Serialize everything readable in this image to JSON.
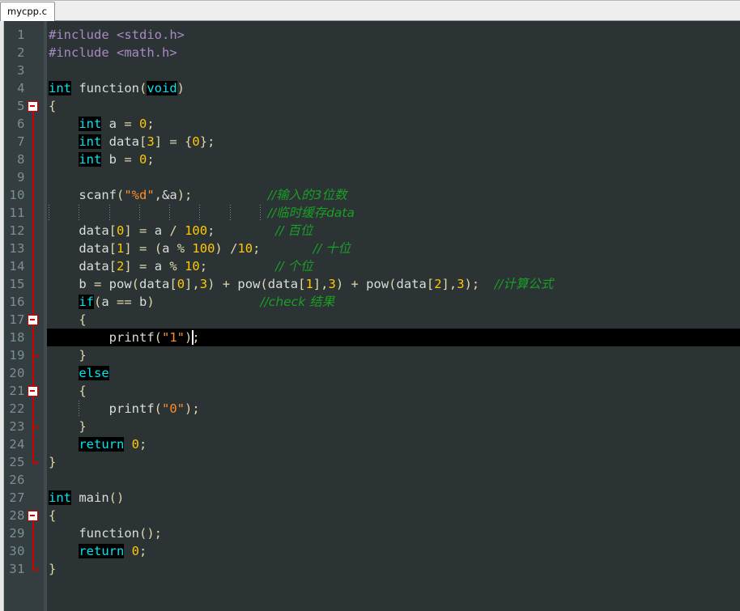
{
  "window": {
    "tabs": [
      {
        "label": "mycpp.c",
        "active": true
      }
    ]
  },
  "editor": {
    "theme": {
      "background": "#2b3335",
      "gutter_background": "#343d40",
      "line_number_color": "#7b9094",
      "current_line_background": "#000000",
      "keyword_color": "#00e5ee",
      "keyword_background": "#000000",
      "preprocessor_color": "#a98ac4",
      "string_color": "#ff8c28",
      "number_color": "#ffc800",
      "bracket_color": "#e0d6a8",
      "comment_color": "#1a9f25",
      "default_text_color": "#dcdcdc",
      "fold_marker_color": "#d00000",
      "caret_color": "#ffffff"
    },
    "current_line": 18,
    "total_lines": 31,
    "language": "C",
    "lines": [
      {
        "n": 1,
        "tokens": [
          {
            "t": "#include ",
            "c": "pre"
          },
          {
            "t": "<stdio.h>",
            "c": "pre"
          }
        ]
      },
      {
        "n": 2,
        "tokens": [
          {
            "t": "#include ",
            "c": "pre"
          },
          {
            "t": "<math.h>",
            "c": "pre"
          }
        ]
      },
      {
        "n": 3,
        "tokens": []
      },
      {
        "n": 4,
        "tokens": [
          {
            "t": "int",
            "c": "kw"
          },
          {
            "t": " function",
            "c": "id"
          },
          {
            "t": "(",
            "c": "brk"
          },
          {
            "t": "void",
            "c": "kw"
          },
          {
            "t": ")",
            "c": "brk"
          }
        ]
      },
      {
        "n": 5,
        "tokens": [
          {
            "t": "{",
            "c": "brk"
          }
        ]
      },
      {
        "n": 6,
        "tokens": [
          {
            "t": "    ",
            "c": "id"
          },
          {
            "t": "int",
            "c": "kw"
          },
          {
            "t": " a ",
            "c": "id"
          },
          {
            "t": "=",
            "c": "op"
          },
          {
            "t": " ",
            "c": "id"
          },
          {
            "t": "0",
            "c": "num"
          },
          {
            "t": ";",
            "c": "op"
          }
        ]
      },
      {
        "n": 7,
        "tokens": [
          {
            "t": "    ",
            "c": "id"
          },
          {
            "t": "int",
            "c": "kw"
          },
          {
            "t": " data",
            "c": "id"
          },
          {
            "t": "[",
            "c": "brk"
          },
          {
            "t": "3",
            "c": "num"
          },
          {
            "t": "]",
            "c": "brk"
          },
          {
            "t": " ",
            "c": "id"
          },
          {
            "t": "=",
            "c": "op"
          },
          {
            "t": " ",
            "c": "id"
          },
          {
            "t": "{",
            "c": "brk"
          },
          {
            "t": "0",
            "c": "num"
          },
          {
            "t": "}",
            "c": "brk"
          },
          {
            "t": ";",
            "c": "op"
          }
        ]
      },
      {
        "n": 8,
        "tokens": [
          {
            "t": "    ",
            "c": "id"
          },
          {
            "t": "int",
            "c": "kw"
          },
          {
            "t": " b ",
            "c": "id"
          },
          {
            "t": "=",
            "c": "op"
          },
          {
            "t": " ",
            "c": "id"
          },
          {
            "t": "0",
            "c": "num"
          },
          {
            "t": ";",
            "c": "op"
          }
        ]
      },
      {
        "n": 9,
        "tokens": []
      },
      {
        "n": 10,
        "tokens": [
          {
            "t": "    scanf",
            "c": "id"
          },
          {
            "t": "(",
            "c": "brk"
          },
          {
            "t": "\"%d\"",
            "c": "str"
          },
          {
            "t": ",",
            "c": "op"
          },
          {
            "t": "&a",
            "c": "id"
          },
          {
            "t": ")",
            "c": "brk"
          },
          {
            "t": ";",
            "c": "op"
          },
          {
            "t": "          ",
            "c": "id"
          },
          {
            "t": "//输入的3位数",
            "c": "cmtcn"
          }
        ]
      },
      {
        "n": 11,
        "tokens": [
          {
            "t": "                             ",
            "c": "id"
          },
          {
            "t": "//临时缓存data",
            "c": "cmtcn"
          }
        ]
      },
      {
        "n": 12,
        "tokens": [
          {
            "t": "    data",
            "c": "id"
          },
          {
            "t": "[",
            "c": "brk"
          },
          {
            "t": "0",
            "c": "num"
          },
          {
            "t": "]",
            "c": "brk"
          },
          {
            "t": " ",
            "c": "id"
          },
          {
            "t": "=",
            "c": "op"
          },
          {
            "t": " a ",
            "c": "id"
          },
          {
            "t": "/",
            "c": "op"
          },
          {
            "t": " ",
            "c": "id"
          },
          {
            "t": "100",
            "c": "num"
          },
          {
            "t": ";",
            "c": "op"
          },
          {
            "t": "        ",
            "c": "id"
          },
          {
            "t": "// 百位",
            "c": "cmtcn"
          }
        ]
      },
      {
        "n": 13,
        "tokens": [
          {
            "t": "    data",
            "c": "id"
          },
          {
            "t": "[",
            "c": "brk"
          },
          {
            "t": "1",
            "c": "num"
          },
          {
            "t": "]",
            "c": "brk"
          },
          {
            "t": " ",
            "c": "id"
          },
          {
            "t": "=",
            "c": "op"
          },
          {
            "t": " ",
            "c": "id"
          },
          {
            "t": "(",
            "c": "brk"
          },
          {
            "t": "a ",
            "c": "id"
          },
          {
            "t": "%",
            "c": "op"
          },
          {
            "t": " ",
            "c": "id"
          },
          {
            "t": "100",
            "c": "num"
          },
          {
            "t": ")",
            "c": "brk"
          },
          {
            "t": " ",
            "c": "id"
          },
          {
            "t": "/",
            "c": "op"
          },
          {
            "t": "10",
            "c": "num"
          },
          {
            "t": ";",
            "c": "op"
          },
          {
            "t": "       ",
            "c": "id"
          },
          {
            "t": "// 十位",
            "c": "cmtcn"
          }
        ]
      },
      {
        "n": 14,
        "tokens": [
          {
            "t": "    data",
            "c": "id"
          },
          {
            "t": "[",
            "c": "brk"
          },
          {
            "t": "2",
            "c": "num"
          },
          {
            "t": "]",
            "c": "brk"
          },
          {
            "t": " ",
            "c": "id"
          },
          {
            "t": "=",
            "c": "op"
          },
          {
            "t": " a ",
            "c": "id"
          },
          {
            "t": "%",
            "c": "op"
          },
          {
            "t": " ",
            "c": "id"
          },
          {
            "t": "10",
            "c": "num"
          },
          {
            "t": ";",
            "c": "op"
          },
          {
            "t": "         ",
            "c": "id"
          },
          {
            "t": "// 个位",
            "c": "cmtcn"
          }
        ]
      },
      {
        "n": 15,
        "tokens": [
          {
            "t": "    b ",
            "c": "id"
          },
          {
            "t": "=",
            "c": "op"
          },
          {
            "t": " pow",
            "c": "id"
          },
          {
            "t": "(",
            "c": "brk"
          },
          {
            "t": "data",
            "c": "id"
          },
          {
            "t": "[",
            "c": "brk"
          },
          {
            "t": "0",
            "c": "num"
          },
          {
            "t": "]",
            "c": "brk"
          },
          {
            "t": ",",
            "c": "op"
          },
          {
            "t": "3",
            "c": "num"
          },
          {
            "t": ")",
            "c": "brk"
          },
          {
            "t": " ",
            "c": "id"
          },
          {
            "t": "+",
            "c": "op"
          },
          {
            "t": " pow",
            "c": "id"
          },
          {
            "t": "(",
            "c": "brk"
          },
          {
            "t": "data",
            "c": "id"
          },
          {
            "t": "[",
            "c": "brk"
          },
          {
            "t": "1",
            "c": "num"
          },
          {
            "t": "]",
            "c": "brk"
          },
          {
            "t": ",",
            "c": "op"
          },
          {
            "t": "3",
            "c": "num"
          },
          {
            "t": ")",
            "c": "brk"
          },
          {
            "t": " ",
            "c": "id"
          },
          {
            "t": "+",
            "c": "op"
          },
          {
            "t": " pow",
            "c": "id"
          },
          {
            "t": "(",
            "c": "brk"
          },
          {
            "t": "data",
            "c": "id"
          },
          {
            "t": "[",
            "c": "brk"
          },
          {
            "t": "2",
            "c": "num"
          },
          {
            "t": "]",
            "c": "brk"
          },
          {
            "t": ",",
            "c": "op"
          },
          {
            "t": "3",
            "c": "num"
          },
          {
            "t": ")",
            "c": "brk"
          },
          {
            "t": ";",
            "c": "op"
          },
          {
            "t": "  ",
            "c": "id"
          },
          {
            "t": "//计算公式",
            "c": "cmtcn"
          }
        ]
      },
      {
        "n": 16,
        "tokens": [
          {
            "t": "    ",
            "c": "id"
          },
          {
            "t": "if",
            "c": "kw"
          },
          {
            "t": "(",
            "c": "brk"
          },
          {
            "t": "a ",
            "c": "id"
          },
          {
            "t": "==",
            "c": "op"
          },
          {
            "t": " b",
            "c": "id"
          },
          {
            "t": ")",
            "c": "brk"
          },
          {
            "t": "              ",
            "c": "id"
          },
          {
            "t": "//check 结果",
            "c": "cmtcn"
          }
        ]
      },
      {
        "n": 17,
        "tokens": [
          {
            "t": "    ",
            "c": "id"
          },
          {
            "t": "{",
            "c": "brk"
          }
        ]
      },
      {
        "n": 18,
        "tokens": [
          {
            "t": "        printf",
            "c": "id"
          },
          {
            "t": "(",
            "c": "brk"
          },
          {
            "t": "\"1\"",
            "c": "str"
          },
          {
            "t": ")",
            "c": "brk"
          },
          {
            "t": ";",
            "c": "op"
          }
        ]
      },
      {
        "n": 19,
        "tokens": [
          {
            "t": "    ",
            "c": "id"
          },
          {
            "t": "}",
            "c": "brk"
          }
        ]
      },
      {
        "n": 20,
        "tokens": [
          {
            "t": "    ",
            "c": "id"
          },
          {
            "t": "else",
            "c": "kw"
          }
        ]
      },
      {
        "n": 21,
        "tokens": [
          {
            "t": "    ",
            "c": "id"
          },
          {
            "t": "{",
            "c": "brk"
          }
        ]
      },
      {
        "n": 22,
        "tokens": [
          {
            "t": "        printf",
            "c": "id"
          },
          {
            "t": "(",
            "c": "brk"
          },
          {
            "t": "\"0\"",
            "c": "str"
          },
          {
            "t": ")",
            "c": "brk"
          },
          {
            "t": ";",
            "c": "op"
          }
        ]
      },
      {
        "n": 23,
        "tokens": [
          {
            "t": "    ",
            "c": "id"
          },
          {
            "t": "}",
            "c": "brk"
          }
        ]
      },
      {
        "n": 24,
        "tokens": [
          {
            "t": "    ",
            "c": "id"
          },
          {
            "t": "return",
            "c": "kw"
          },
          {
            "t": " ",
            "c": "id"
          },
          {
            "t": "0",
            "c": "num"
          },
          {
            "t": ";",
            "c": "op"
          }
        ]
      },
      {
        "n": 25,
        "tokens": [
          {
            "t": "}",
            "c": "brk"
          }
        ]
      },
      {
        "n": 26,
        "tokens": []
      },
      {
        "n": 27,
        "tokens": [
          {
            "t": "int",
            "c": "kw"
          },
          {
            "t": " main",
            "c": "id"
          },
          {
            "t": "(",
            "c": "brk"
          },
          {
            "t": ")",
            "c": "brk"
          }
        ]
      },
      {
        "n": 28,
        "tokens": [
          {
            "t": "{",
            "c": "brk"
          }
        ]
      },
      {
        "n": 29,
        "tokens": [
          {
            "t": "    function",
            "c": "id"
          },
          {
            "t": "(",
            "c": "brk"
          },
          {
            "t": ")",
            "c": "brk"
          },
          {
            "t": ";",
            "c": "op"
          }
        ]
      },
      {
        "n": 30,
        "tokens": [
          {
            "t": "    ",
            "c": "id"
          },
          {
            "t": "return",
            "c": "kw"
          },
          {
            "t": " ",
            "c": "id"
          },
          {
            "t": "0",
            "c": "num"
          },
          {
            "t": ";",
            "c": "op"
          }
        ]
      },
      {
        "n": 31,
        "tokens": [
          {
            "t": "}",
            "c": "brk"
          }
        ]
      }
    ],
    "fold_markers": [
      {
        "line": 5,
        "type": "open"
      },
      {
        "line": 17,
        "type": "open"
      },
      {
        "line": 21,
        "type": "open"
      },
      {
        "line": 28,
        "type": "open"
      }
    ],
    "fold_ranges": [
      {
        "start": 5,
        "end": 25
      },
      {
        "start": 17,
        "end": 19
      },
      {
        "start": 21,
        "end": 23
      },
      {
        "start": 28,
        "end": 31
      }
    ],
    "indent_guides": [
      {
        "line": 11,
        "columns": [
          0,
          4,
          8,
          12,
          16,
          20,
          24,
          28
        ]
      },
      {
        "line": 22,
        "columns": [
          4
        ]
      }
    ],
    "caret": {
      "line": 18,
      "column": 19
    }
  }
}
